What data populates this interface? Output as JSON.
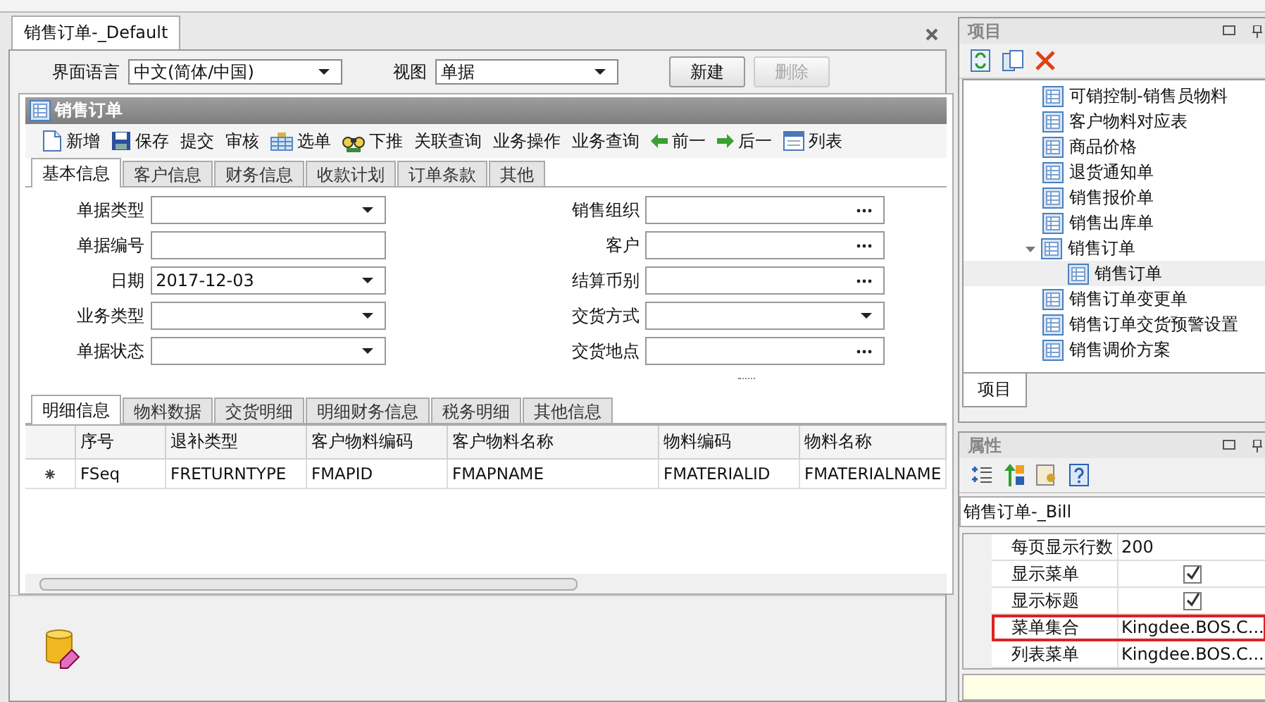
{
  "document_tab": {
    "label": "销售订单-_Default",
    "selected": true
  },
  "view_bar": {
    "language": {
      "label": "界面语言",
      "value": "中文(简体/中国)"
    },
    "view": {
      "label": "视图",
      "value": "单据"
    },
    "buttons": [
      {
        "label": "新建",
        "disabled": false
      },
      {
        "label": "删除",
        "disabled": true
      }
    ]
  },
  "form": {
    "title": "销售订单",
    "toolbar": [
      {
        "label": "新增",
        "kind": "new"
      },
      {
        "label": "保存",
        "kind": "save"
      },
      {
        "label": "提交",
        "kind": "plain"
      },
      {
        "label": "审核",
        "kind": "plain"
      },
      {
        "label": "选单",
        "kind": "pick"
      },
      {
        "label": "下推",
        "kind": "push"
      },
      {
        "label": "关联查询",
        "kind": "plain"
      },
      {
        "label": "业务操作",
        "kind": "plain"
      },
      {
        "label": "业务查询",
        "kind": "plain"
      },
      {
        "label": "前一",
        "kind": "previous"
      },
      {
        "label": "后一",
        "kind": "next"
      },
      {
        "label": "列表",
        "kind": "list"
      }
    ],
    "tabs": [
      {
        "label": "基本信息",
        "selected": true
      },
      {
        "label": "客户信息",
        "selected": false
      },
      {
        "label": "财务信息",
        "selected": false
      },
      {
        "label": "收款计划",
        "selected": false
      },
      {
        "label": "订单条款",
        "selected": false
      },
      {
        "label": "其他",
        "selected": false
      }
    ],
    "left_fields": [
      {
        "label": "单据类型",
        "kind": "dropdown"
      },
      {
        "label": "单据编号",
        "kind": "text"
      },
      {
        "label": "日期",
        "kind": "dropdown",
        "value": "2017-12-03"
      },
      {
        "label": "业务类型",
        "kind": "dropdown"
      },
      {
        "label": "单据状态",
        "kind": "dropdown"
      }
    ],
    "right_fields": [
      {
        "label": "销售组织",
        "kind": "lookup"
      },
      {
        "label": "客户",
        "kind": "lookup"
      },
      {
        "label": "结算币别",
        "kind": "lookup"
      },
      {
        "label": "交货方式",
        "kind": "dropdown"
      },
      {
        "label": "交货地点",
        "kind": "lookup"
      }
    ],
    "detail_tabs": [
      {
        "label": "明细信息",
        "selected": true
      },
      {
        "label": "物料数据",
        "selected": false
      },
      {
        "label": "交货明细",
        "selected": false
      },
      {
        "label": "明细财务信息",
        "selected": false
      },
      {
        "label": "税务明细",
        "selected": false
      },
      {
        "label": "其他信息",
        "selected": false
      }
    ],
    "grid": {
      "columns": [
        "序号",
        "退补类型",
        "客户物料编码",
        "客户物料名称",
        "物料编码",
        "物料名称"
      ],
      "rows": [
        [
          "FSeq",
          "FRETURNTYPE",
          "FMAPID",
          "FMAPNAME",
          "FMATERIALID",
          "FMATERIALNAME"
        ]
      ]
    }
  },
  "project_panel": {
    "title": "项目",
    "tree": [
      {
        "label": "可销控制-销售员物料",
        "selected": false
      },
      {
        "label": "客户物料对应表",
        "selected": false
      },
      {
        "label": "商品价格",
        "selected": false
      },
      {
        "label": "退货通知单",
        "selected": false
      },
      {
        "label": "销售报价单",
        "selected": false
      },
      {
        "label": "销售出库单",
        "selected": false
      },
      {
        "label": "销售订单",
        "selected": false,
        "expanded": true,
        "children": [
          {
            "label": "销售订单",
            "selected": true
          }
        ]
      },
      {
        "label": "销售订单变更单",
        "selected": false
      },
      {
        "label": "销售订单交货预警设置",
        "selected": false
      },
      {
        "label": "销售调价方案",
        "selected": false
      }
    ],
    "tabs": [
      {
        "label": "项目",
        "selected": true
      }
    ]
  },
  "properties_panel": {
    "title": "属性",
    "object": "销售订单-_Bill",
    "rows": [
      {
        "name": "每页显示行数",
        "kind": "text",
        "value": "200",
        "selected": false
      },
      {
        "name": "显示菜单",
        "kind": "check",
        "checked": true,
        "selected": false
      },
      {
        "name": "显示标题",
        "kind": "check",
        "checked": true,
        "selected": false
      },
      {
        "name": "菜单集合",
        "kind": "text",
        "value": "Kingdee.BOS.C...",
        "selected": true
      },
      {
        "name": "列表菜单",
        "kind": "text",
        "value": "Kingdee.BOS.C...",
        "selected": false
      }
    ]
  }
}
